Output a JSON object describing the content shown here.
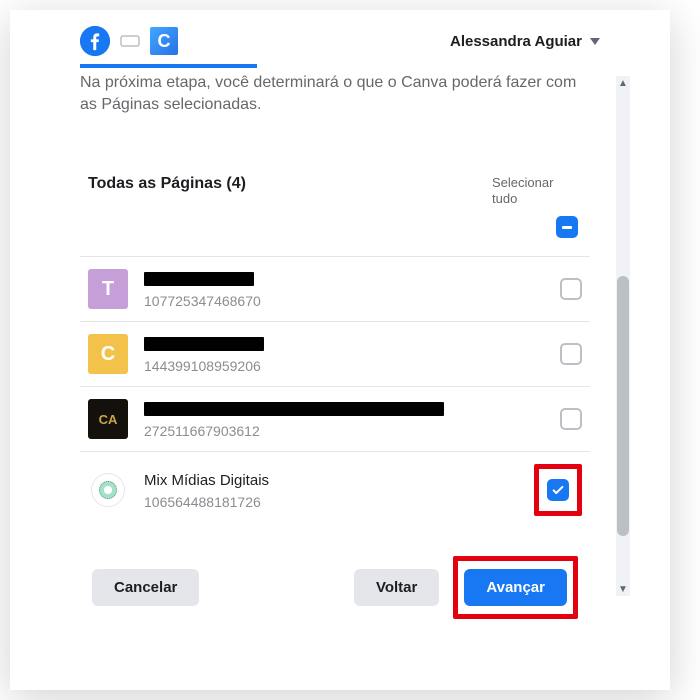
{
  "header": {
    "app_letter": "C",
    "user_name": "Alessandra Aguiar"
  },
  "intro": "Na próxima etapa, você determinará o que o Canva poderá fazer com as Páginas selecionadas.",
  "list": {
    "title": "Todas as Páginas (4)",
    "select_all_label": "Selecionar tudo"
  },
  "pages": [
    {
      "avatar_letter": "T",
      "avatar_bg": "#c69fd8",
      "avatar_fg": "#ffffff",
      "name_redacted": true,
      "redacted_width": 110,
      "name": "",
      "id": "107725347468670",
      "checked": false
    },
    {
      "avatar_letter": "C",
      "avatar_bg": "#f3c24a",
      "avatar_fg": "#ffffff",
      "name_redacted": true,
      "redacted_width": 120,
      "name": "",
      "id": "144399108959206",
      "checked": false
    },
    {
      "avatar_letter": "CA",
      "avatar_bg": "#14110d",
      "avatar_fg": "#c9a54a",
      "name_redacted": true,
      "redacted_width": 300,
      "name": "",
      "id": "272511667903612",
      "checked": false
    },
    {
      "avatar_letter": "",
      "avatar_bg": "#ffffff",
      "avatar_fg": "#000000",
      "name_redacted": false,
      "redacted_width": 0,
      "name": "Mix Mídias Digitais",
      "id": "106564488181726",
      "checked": true
    }
  ],
  "footer": {
    "cancel": "Cancelar",
    "back": "Voltar",
    "next": "Avançar"
  }
}
